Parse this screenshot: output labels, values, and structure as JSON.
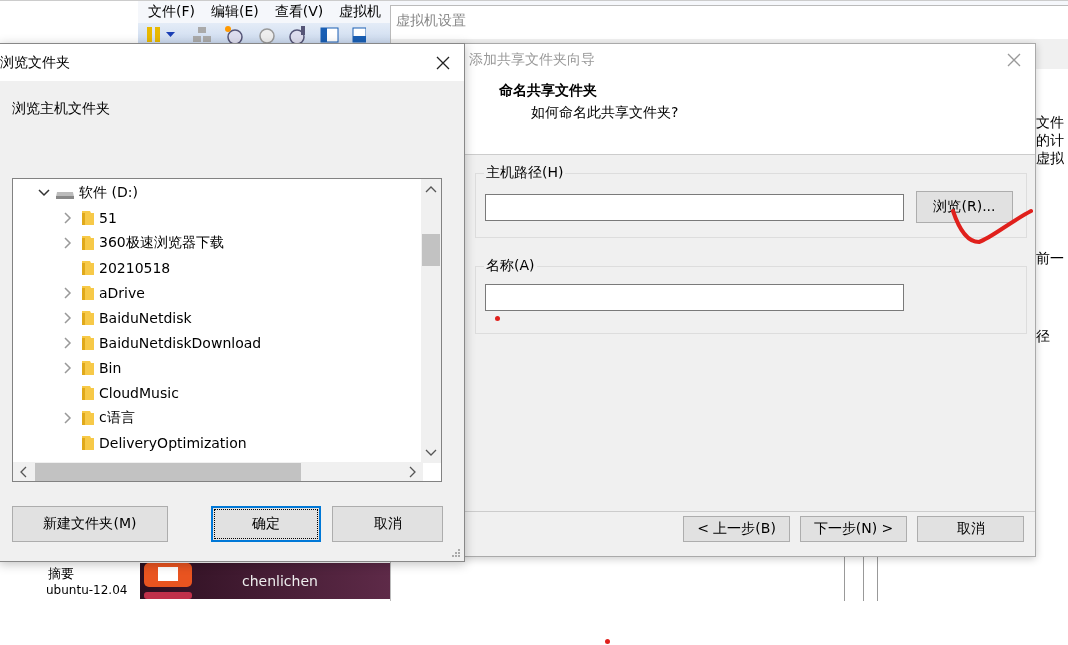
{
  "vmware_window": {
    "menu": [
      "文件(F)",
      "编辑(E)",
      "查看(V)",
      "虚拟机"
    ],
    "summary_label": "摘要",
    "vm_name": "ubuntu-12.04",
    "vm_screen_user": "chenlichen"
  },
  "settings_window": {
    "title": "虚拟机设置",
    "side_texts": [
      "文件",
      "的计",
      "虚拟",
      "前一",
      "径"
    ]
  },
  "wizard": {
    "title": "添加共享文件夹向导",
    "heading": "命名共享文件夹",
    "subheading": "如何命名此共享文件夹?",
    "host_path": {
      "label": "主机路径(H)",
      "button": "浏览(R)..."
    },
    "name": {
      "label": "名称(A)"
    },
    "buttons": [
      {
        "label": "< 上一步(B)",
        "focused": false
      },
      {
        "label": "下一步(N) >",
        "focused": false
      },
      {
        "label": "取消",
        "focused": false
      }
    ]
  },
  "browse_dialog": {
    "title": "浏览文件夹",
    "prompt": "浏览主机文件夹",
    "tree": {
      "label": "软件 (D:)",
      "expanded": true,
      "children": [
        {
          "label": "51",
          "has_children": true
        },
        {
          "label": "360极速浏览器下载",
          "has_children": true
        },
        {
          "label": "20210518",
          "has_children": false
        },
        {
          "label": "aDrive",
          "has_children": true
        },
        {
          "label": "BaiduNetdisk",
          "has_children": true
        },
        {
          "label": "BaiduNetdiskDownload",
          "has_children": true
        },
        {
          "label": "Bin",
          "has_children": true
        },
        {
          "label": "CloudMusic",
          "has_children": false
        },
        {
          "label": "c语言",
          "has_children": true
        },
        {
          "label": "DeliveryOptimization",
          "has_children": false
        }
      ]
    },
    "buttons": [
      {
        "label": "新建文件夹(M)",
        "focused": false
      },
      {
        "label": "确定",
        "focused": true
      },
      {
        "label": "取消",
        "focused": false
      }
    ]
  }
}
